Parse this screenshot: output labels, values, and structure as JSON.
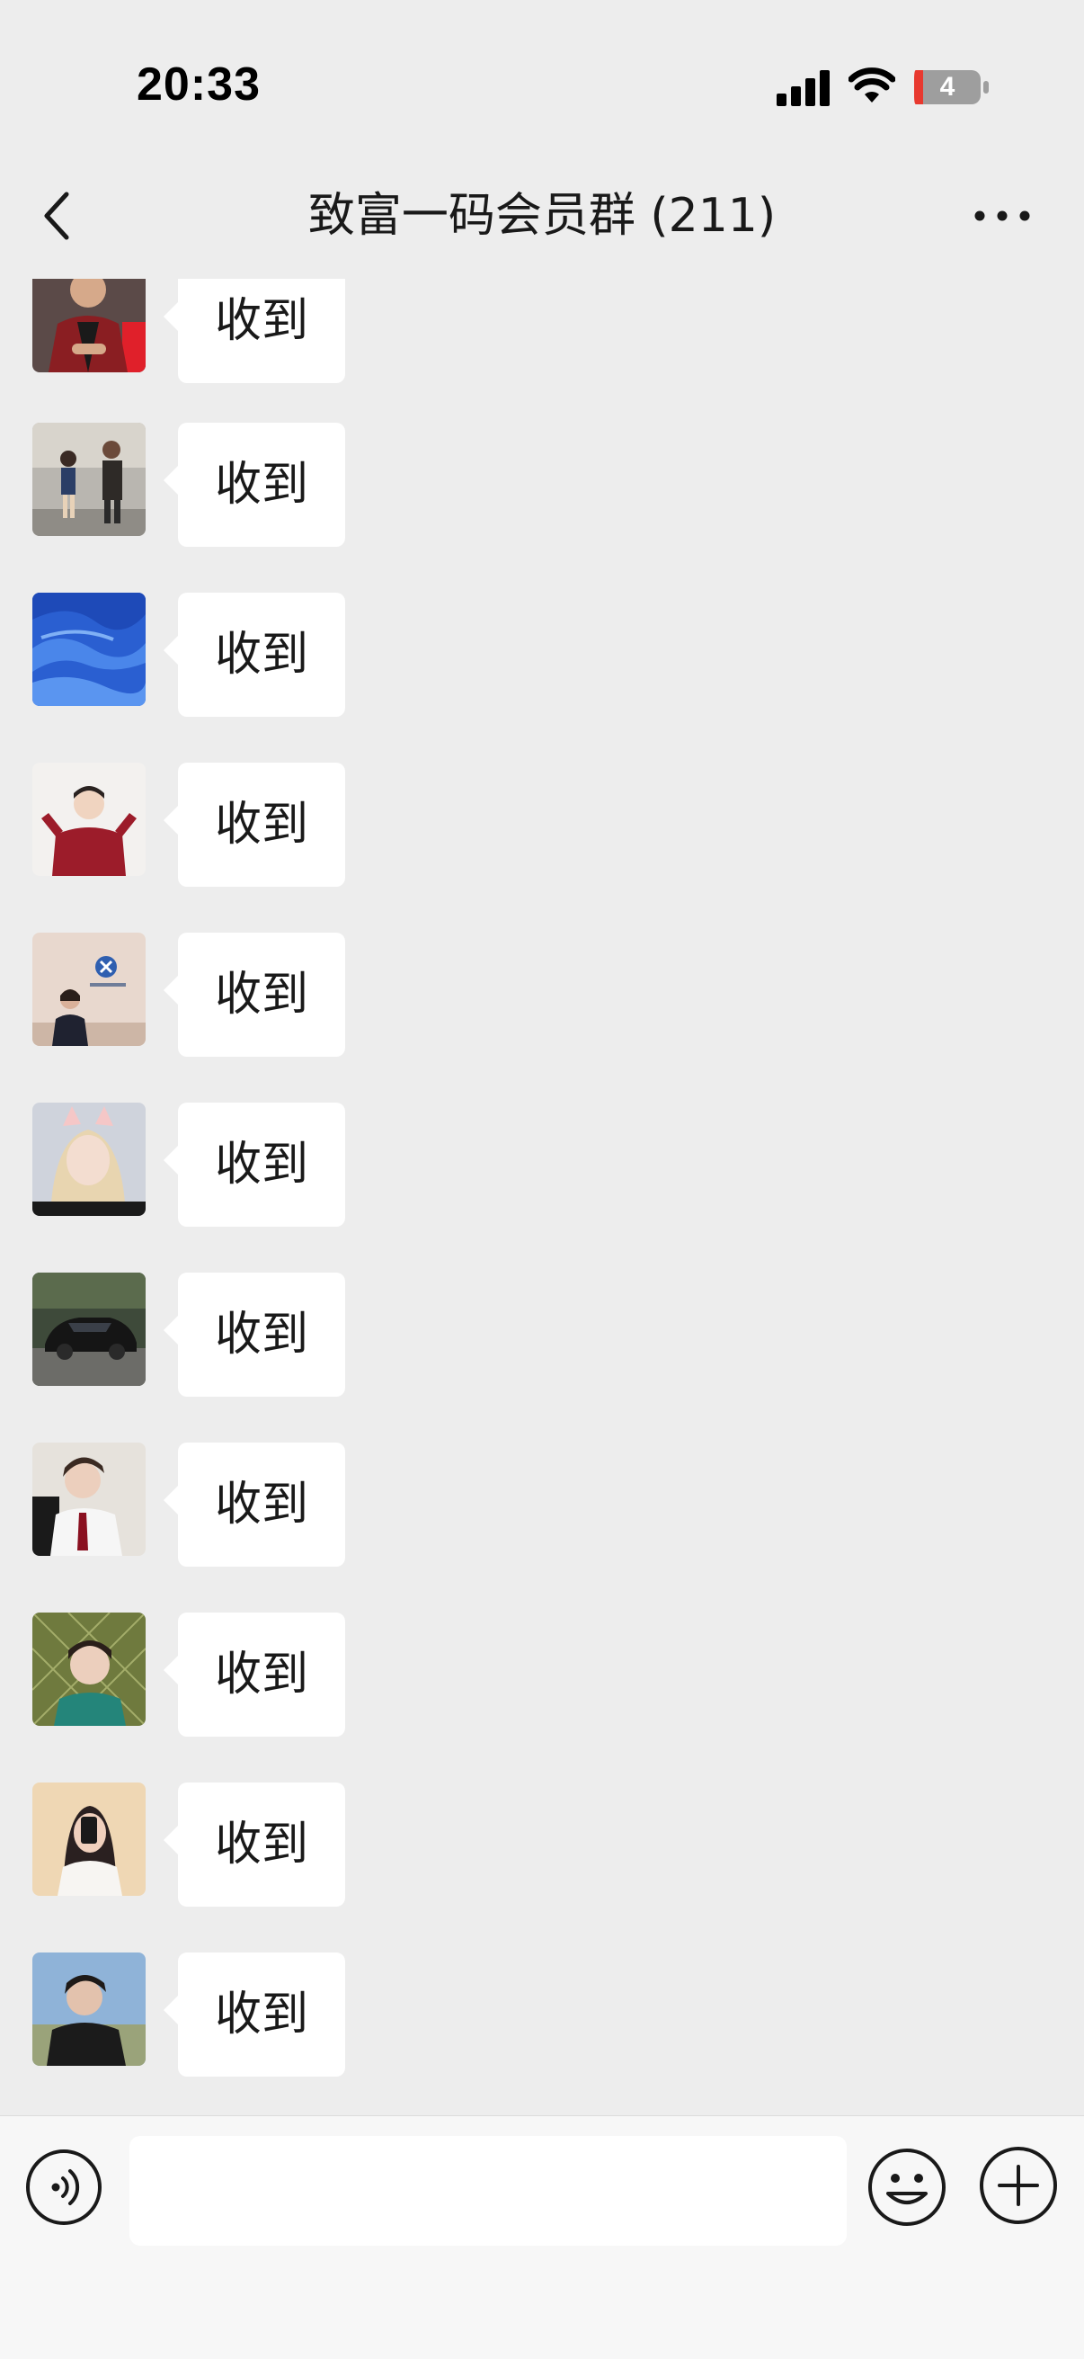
{
  "status_bar": {
    "time": "20:33",
    "battery_level": "4",
    "signal_icon": "cellular-signal-icon",
    "wifi_icon": "wifi-icon",
    "battery_icon": "battery-icon"
  },
  "nav": {
    "title": "致富一码会员群 (211)",
    "back_icon": "chevron-left-icon",
    "more_icon": "more-dots-icon"
  },
  "messages": [
    {
      "text": "收到",
      "avatar": "avatar-man-red-shirt"
    },
    {
      "text": "收到",
      "avatar": "avatar-two-people-street"
    },
    {
      "text": "收到",
      "avatar": "avatar-blue-fabric"
    },
    {
      "text": "收到",
      "avatar": "avatar-boy-red-hoodie"
    },
    {
      "text": "收到",
      "avatar": "avatar-woman-office-logo"
    },
    {
      "text": "收到",
      "avatar": "avatar-girl-cat-ears"
    },
    {
      "text": "收到",
      "avatar": "avatar-black-sports-car"
    },
    {
      "text": "收到",
      "avatar": "avatar-man-white-shirt-tie"
    },
    {
      "text": "收到",
      "avatar": "avatar-boy-fence"
    },
    {
      "text": "收到",
      "avatar": "avatar-girl-phone-selfie"
    },
    {
      "text": "收到",
      "avatar": "avatar-man-black-hoodie"
    }
  ],
  "input_bar": {
    "voice_icon": "voice-icon",
    "placeholder": "",
    "value": "",
    "emoji_icon": "emoji-icon",
    "plus_icon": "plus-icon"
  },
  "colors": {
    "background": "#ededed",
    "bubble": "#ffffff",
    "input_bar": "#f7f7f7",
    "battery_low": "#e8392f"
  }
}
